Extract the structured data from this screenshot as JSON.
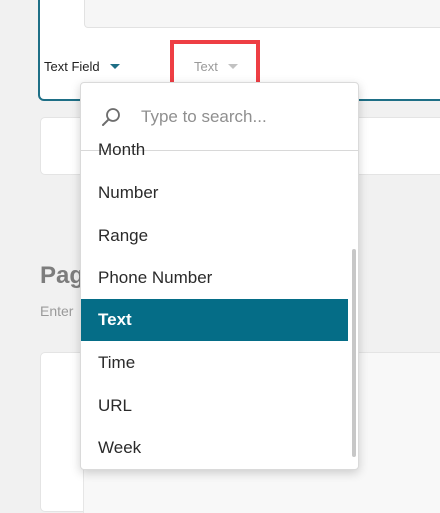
{
  "field_card": {
    "type_select_label": "Text Field",
    "subtype_select_label": "Text"
  },
  "page_section": {
    "heading": "Pag",
    "subtext": "Enter"
  },
  "dropdown": {
    "search_placeholder": "Type to search...",
    "options": [
      {
        "label": "Month",
        "selected": false
      },
      {
        "label": "Number",
        "selected": false
      },
      {
        "label": "Range",
        "selected": false
      },
      {
        "label": "Phone Number",
        "selected": false
      },
      {
        "label": "Text",
        "selected": true
      },
      {
        "label": "Time",
        "selected": false
      },
      {
        "label": "URL",
        "selected": false
      },
      {
        "label": "Week",
        "selected": false
      }
    ]
  },
  "colors": {
    "accent": "#056d87",
    "highlight": "#ee3e44"
  },
  "icons": {
    "search": "search-icon",
    "caret": "chevron-down-icon"
  }
}
